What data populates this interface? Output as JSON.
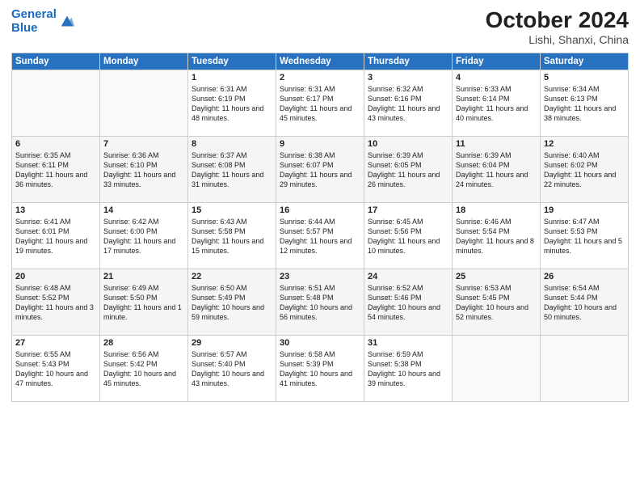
{
  "header": {
    "logo_line1": "General",
    "logo_line2": "Blue",
    "month_year": "October 2024",
    "location": "Lishi, Shanxi, China"
  },
  "days_of_week": [
    "Sunday",
    "Monday",
    "Tuesday",
    "Wednesday",
    "Thursday",
    "Friday",
    "Saturday"
  ],
  "weeks": [
    [
      {
        "day": "",
        "text": ""
      },
      {
        "day": "",
        "text": ""
      },
      {
        "day": "1",
        "text": "Sunrise: 6:31 AM\nSunset: 6:19 PM\nDaylight: 11 hours and 48 minutes."
      },
      {
        "day": "2",
        "text": "Sunrise: 6:31 AM\nSunset: 6:17 PM\nDaylight: 11 hours and 45 minutes."
      },
      {
        "day": "3",
        "text": "Sunrise: 6:32 AM\nSunset: 6:16 PM\nDaylight: 11 hours and 43 minutes."
      },
      {
        "day": "4",
        "text": "Sunrise: 6:33 AM\nSunset: 6:14 PM\nDaylight: 11 hours and 40 minutes."
      },
      {
        "day": "5",
        "text": "Sunrise: 6:34 AM\nSunset: 6:13 PM\nDaylight: 11 hours and 38 minutes."
      }
    ],
    [
      {
        "day": "6",
        "text": "Sunrise: 6:35 AM\nSunset: 6:11 PM\nDaylight: 11 hours and 36 minutes."
      },
      {
        "day": "7",
        "text": "Sunrise: 6:36 AM\nSunset: 6:10 PM\nDaylight: 11 hours and 33 minutes."
      },
      {
        "day": "8",
        "text": "Sunrise: 6:37 AM\nSunset: 6:08 PM\nDaylight: 11 hours and 31 minutes."
      },
      {
        "day": "9",
        "text": "Sunrise: 6:38 AM\nSunset: 6:07 PM\nDaylight: 11 hours and 29 minutes."
      },
      {
        "day": "10",
        "text": "Sunrise: 6:39 AM\nSunset: 6:05 PM\nDaylight: 11 hours and 26 minutes."
      },
      {
        "day": "11",
        "text": "Sunrise: 6:39 AM\nSunset: 6:04 PM\nDaylight: 11 hours and 24 minutes."
      },
      {
        "day": "12",
        "text": "Sunrise: 6:40 AM\nSunset: 6:02 PM\nDaylight: 11 hours and 22 minutes."
      }
    ],
    [
      {
        "day": "13",
        "text": "Sunrise: 6:41 AM\nSunset: 6:01 PM\nDaylight: 11 hours and 19 minutes."
      },
      {
        "day": "14",
        "text": "Sunrise: 6:42 AM\nSunset: 6:00 PM\nDaylight: 11 hours and 17 minutes."
      },
      {
        "day": "15",
        "text": "Sunrise: 6:43 AM\nSunset: 5:58 PM\nDaylight: 11 hours and 15 minutes."
      },
      {
        "day": "16",
        "text": "Sunrise: 6:44 AM\nSunset: 5:57 PM\nDaylight: 11 hours and 12 minutes."
      },
      {
        "day": "17",
        "text": "Sunrise: 6:45 AM\nSunset: 5:56 PM\nDaylight: 11 hours and 10 minutes."
      },
      {
        "day": "18",
        "text": "Sunrise: 6:46 AM\nSunset: 5:54 PM\nDaylight: 11 hours and 8 minutes."
      },
      {
        "day": "19",
        "text": "Sunrise: 6:47 AM\nSunset: 5:53 PM\nDaylight: 11 hours and 5 minutes."
      }
    ],
    [
      {
        "day": "20",
        "text": "Sunrise: 6:48 AM\nSunset: 5:52 PM\nDaylight: 11 hours and 3 minutes."
      },
      {
        "day": "21",
        "text": "Sunrise: 6:49 AM\nSunset: 5:50 PM\nDaylight: 11 hours and 1 minute."
      },
      {
        "day": "22",
        "text": "Sunrise: 6:50 AM\nSunset: 5:49 PM\nDaylight: 10 hours and 59 minutes."
      },
      {
        "day": "23",
        "text": "Sunrise: 6:51 AM\nSunset: 5:48 PM\nDaylight: 10 hours and 56 minutes."
      },
      {
        "day": "24",
        "text": "Sunrise: 6:52 AM\nSunset: 5:46 PM\nDaylight: 10 hours and 54 minutes."
      },
      {
        "day": "25",
        "text": "Sunrise: 6:53 AM\nSunset: 5:45 PM\nDaylight: 10 hours and 52 minutes."
      },
      {
        "day": "26",
        "text": "Sunrise: 6:54 AM\nSunset: 5:44 PM\nDaylight: 10 hours and 50 minutes."
      }
    ],
    [
      {
        "day": "27",
        "text": "Sunrise: 6:55 AM\nSunset: 5:43 PM\nDaylight: 10 hours and 47 minutes."
      },
      {
        "day": "28",
        "text": "Sunrise: 6:56 AM\nSunset: 5:42 PM\nDaylight: 10 hours and 45 minutes."
      },
      {
        "day": "29",
        "text": "Sunrise: 6:57 AM\nSunset: 5:40 PM\nDaylight: 10 hours and 43 minutes."
      },
      {
        "day": "30",
        "text": "Sunrise: 6:58 AM\nSunset: 5:39 PM\nDaylight: 10 hours and 41 minutes."
      },
      {
        "day": "31",
        "text": "Sunrise: 6:59 AM\nSunset: 5:38 PM\nDaylight: 10 hours and 39 minutes."
      },
      {
        "day": "",
        "text": ""
      },
      {
        "day": "",
        "text": ""
      }
    ]
  ]
}
